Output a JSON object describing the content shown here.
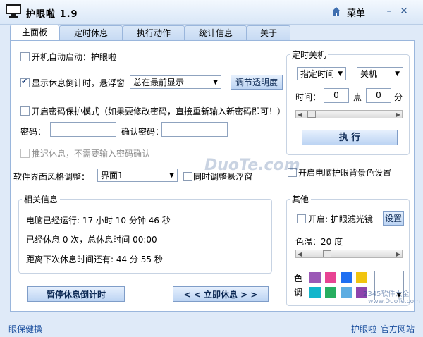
{
  "window": {
    "title": "护眼啦 1.9",
    "menu_label": "菜单",
    "minimize": "–",
    "close": "✕"
  },
  "tabs": [
    {
      "label": "主面板",
      "active": true
    },
    {
      "label": "定时休息"
    },
    {
      "label": "执行动作"
    },
    {
      "label": "统计信息"
    },
    {
      "label": "关于"
    }
  ],
  "main": {
    "autostart_label": "开机自动启动：护眼啦",
    "show_countdown_label": "显示休息倒计时，悬浮窗",
    "float_mode_value": "总在最前显示",
    "adjust_opacity_button": "调节透明度",
    "password_mode_label": "开启密码保护模式（如果要修改密码，直接重新输入新密码即可！）",
    "password_label": "密码：",
    "confirm_password_label": "确认密码：",
    "delay_rest_label": "推迟休息，不需要输入密码确认",
    "style_label": "软件界面风格调整：",
    "style_value": "界面1",
    "sync_float_label": "同时调整悬浮窗",
    "bg_color_label": "开启电脑护眼背景色设置"
  },
  "shutdown": {
    "title": "定时关机",
    "mode_value": "指定时间",
    "action_value": "关机",
    "time_label": "时间：",
    "hour_value": "0",
    "point_label": "点",
    "minute_value": "0",
    "minute_label": "分",
    "execute_button": "执 行"
  },
  "info": {
    "title": "相关信息",
    "uptime": "电脑已经运行: 17 小时 10 分钟 46 秒",
    "rest_total": "已经休息 0 次，总休息时间 00:00",
    "next_rest": "距离下次休息时间还有: 44 分 55 秒",
    "pause_button": "暂停休息倒计时",
    "rest_now_button": "< < 立即休息 > >"
  },
  "other": {
    "title": "其他",
    "filter_label": "开启: 护眼滤光镜",
    "settings_button": "设置",
    "color_temp_label": "色温：20 度",
    "color_label_1": "色",
    "color_label_2": "调",
    "swatches": [
      "#9b59b6",
      "#e84393",
      "#1e6ff2",
      "#f1c40f",
      "#12b5cb",
      "#27ae60",
      "#5dade2",
      "#8e44ad"
    ]
  },
  "footer": {
    "left_link": "眼保健操",
    "right_link_1": "护眼啦",
    "right_link_2": "官方网站"
  },
  "watermark": {
    "text_1": "DuoTe.com",
    "text_2": "2345软件大全",
    "text_3": "www.DuoTe.com"
  }
}
